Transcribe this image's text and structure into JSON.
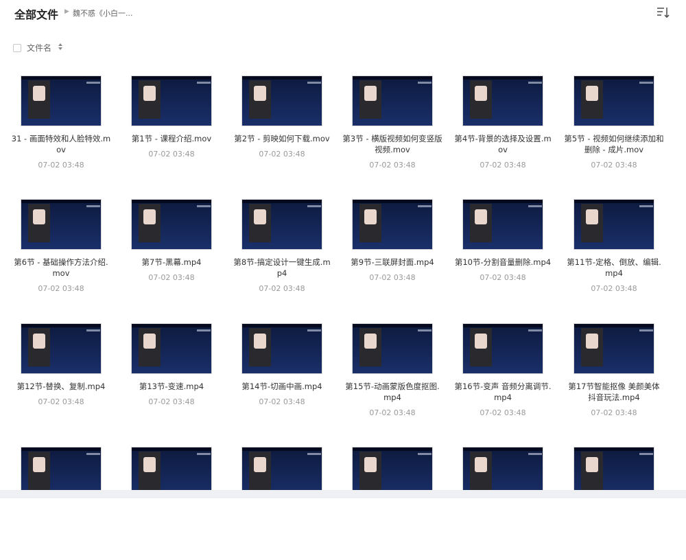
{
  "header": {
    "title": "全部文件",
    "breadcrumb": "魏不惑《小白一..."
  },
  "columns": {
    "name_label": "文件名"
  },
  "files": [
    {
      "name": "31 - 画面特效和人脸特效.mov",
      "date": "07-02 03:48"
    },
    {
      "name": "第1节 - 课程介绍.mov",
      "date": "07-02 03:48"
    },
    {
      "name": "第2节 - 剪映如何下载.mov",
      "date": "07-02 03:48"
    },
    {
      "name": "第3节 - 横版视频如何变竖版视频.mov",
      "date": "07-02 03:48"
    },
    {
      "name": "第4节-背景的选择及设置.mov",
      "date": "07-02 03:48"
    },
    {
      "name": "第5节 - 视频如何继续添加和删除 - 成片.mov",
      "date": "07-02 03:48"
    },
    {
      "name": "第6节 - 基础操作方法介绍.mov",
      "date": "07-02 03:48"
    },
    {
      "name": "第7节-黑幕.mp4",
      "date": "07-02 03:48"
    },
    {
      "name": "第8节-搞定设计一键生成.mp4",
      "date": "07-02 03:48"
    },
    {
      "name": "第9节-三联屏封面.mp4",
      "date": "07-02 03:48"
    },
    {
      "name": "第10节-分割音量删除.mp4",
      "date": "07-02 03:48"
    },
    {
      "name": "第11节-定格、倒放、编辑.mp4",
      "date": "07-02 03:48"
    },
    {
      "name": "第12节-替换、复制.mp4",
      "date": "07-02 03:48"
    },
    {
      "name": "第13节-变速.mp4",
      "date": "07-02 03:48"
    },
    {
      "name": "第14节-切画中画.mp4",
      "date": "07-02 03:48"
    },
    {
      "name": "第15节-动画蒙版色度抠图.mp4",
      "date": "07-02 03:48"
    },
    {
      "name": "第16节-变声 音频分离调节.mp4",
      "date": "07-02 03:48"
    },
    {
      "name": "第17节智能抠像 美颜美体 抖音玩法.mp4",
      "date": "07-02 03:48"
    },
    {
      "name": "",
      "date": ""
    },
    {
      "name": "",
      "date": ""
    },
    {
      "name": "",
      "date": ""
    },
    {
      "name": "",
      "date": ""
    },
    {
      "name": "",
      "date": ""
    },
    {
      "name": "",
      "date": ""
    }
  ]
}
